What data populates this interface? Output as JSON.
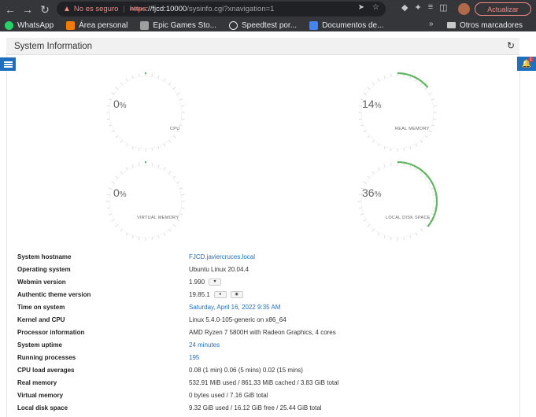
{
  "browser": {
    "security_label": "No es seguro",
    "url_scheme": "https",
    "url_host": "://fjcd:10000",
    "url_path": "/sysinfo.cgi?xnavigation=1",
    "update_label": "Actualizar",
    "bookmarks": [
      {
        "label": "WhatsApp",
        "color": "#25d366"
      },
      {
        "label": "Área personal",
        "color": "#f57c00"
      },
      {
        "label": "Epic Games Sto...",
        "color": "#9e9e9e"
      },
      {
        "label": "Speedtest por...",
        "color": "#e8eaed"
      },
      {
        "label": "Documentos de...",
        "color": "#4285f4"
      }
    ],
    "other_bookmarks": "Otros marcadores"
  },
  "header": {
    "title": "System Information"
  },
  "notifications": {
    "count": "1"
  },
  "gauges": {
    "cpu": {
      "value": "0",
      "unit": "%",
      "label": "CPU",
      "fraction": 0.0
    },
    "real_memory": {
      "value": "14",
      "unit": "%",
      "label": "REAL MEMORY",
      "fraction": 0.14
    },
    "virtual_memory": {
      "value": "0",
      "unit": "%",
      "label": "VIRTUAL MEMORY",
      "fraction": 0.0
    },
    "local_disk": {
      "value": "36",
      "unit": "%",
      "label": "LOCAL DISK SPACE",
      "fraction": 0.36
    }
  },
  "accent_color": "#5cb85c",
  "info": {
    "hostname": {
      "label": "System hostname",
      "value": "FJCD.javiercruces.local"
    },
    "os": {
      "label": "Operating system",
      "value": "Ubuntu Linux 20.04.4"
    },
    "webmin": {
      "label": "Webmin version",
      "value": "1.990"
    },
    "theme": {
      "label": "Authentic theme version",
      "value": "19.85.1"
    },
    "time": {
      "label": "Time on system",
      "value": "Saturday, April 16, 2022 9:35 AM"
    },
    "kernel": {
      "label": "Kernel and CPU",
      "value": "Linux 5.4.0-105-generic on x86_64"
    },
    "processor": {
      "label": "Processor information",
      "value": "AMD Ryzen 7 5800H with Radeon Graphics, 4 cores"
    },
    "uptime": {
      "label": "System uptime",
      "value": "24 minutes"
    },
    "processes": {
      "label": "Running processes",
      "value": "195"
    },
    "load": {
      "label": "CPU load averages",
      "value": "0.08 (1 min) 0.06 (5 mins) 0.02 (15 mins)"
    },
    "real_memory": {
      "label": "Real memory",
      "value": "532.91 MiB used / 861.33 MiB cached / 3.83 GiB total"
    },
    "virtual_memory": {
      "label": "Virtual memory",
      "value": "0 bytes used / 7.16 GiB total"
    },
    "disk": {
      "label": "Local disk space",
      "value": "9.32 GiB used / 16.12 GiB free / 25.44 GiB total"
    }
  }
}
